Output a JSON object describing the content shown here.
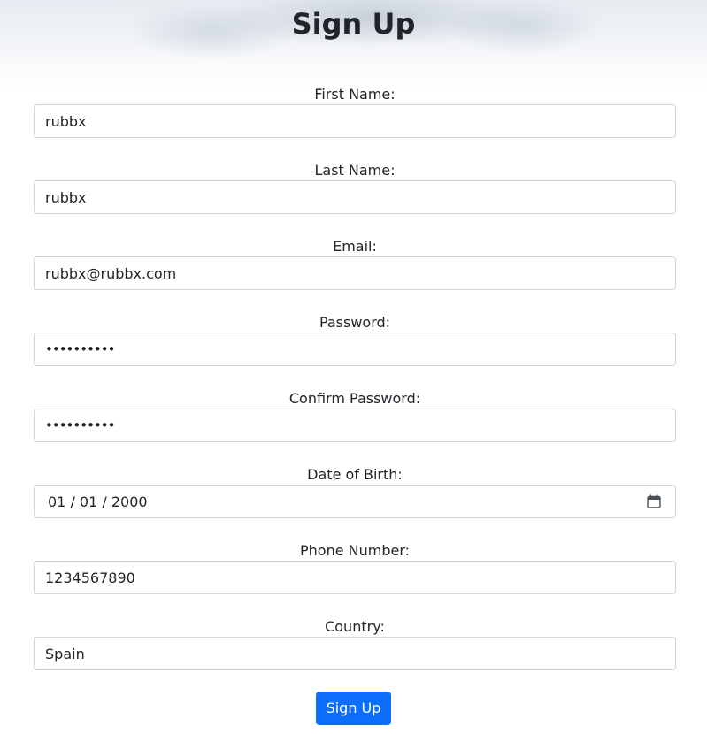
{
  "page": {
    "title": "Sign Up"
  },
  "form": {
    "first_name": {
      "label": "First Name:",
      "value": "rubbx"
    },
    "last_name": {
      "label": "Last Name:",
      "value": "rubbx"
    },
    "email": {
      "label": "Email:",
      "value": "rubbx@rubbx.com"
    },
    "password": {
      "label": "Password:",
      "value": "••••••••••"
    },
    "confirm_password": {
      "label": "Confirm Password:",
      "value": "••••••••••"
    },
    "date_of_birth": {
      "label": "Date of Birth:",
      "value": "01 / 01 / 2000",
      "icon": "calendar-icon"
    },
    "phone": {
      "label": "Phone Number:",
      "value": "1234567890"
    },
    "country": {
      "label": "Country:",
      "value": "Spain"
    },
    "submit_label": "Sign Up"
  },
  "colors": {
    "primary_button": "#0d6efd",
    "input_border": "#ced4da",
    "text": "#212529"
  }
}
